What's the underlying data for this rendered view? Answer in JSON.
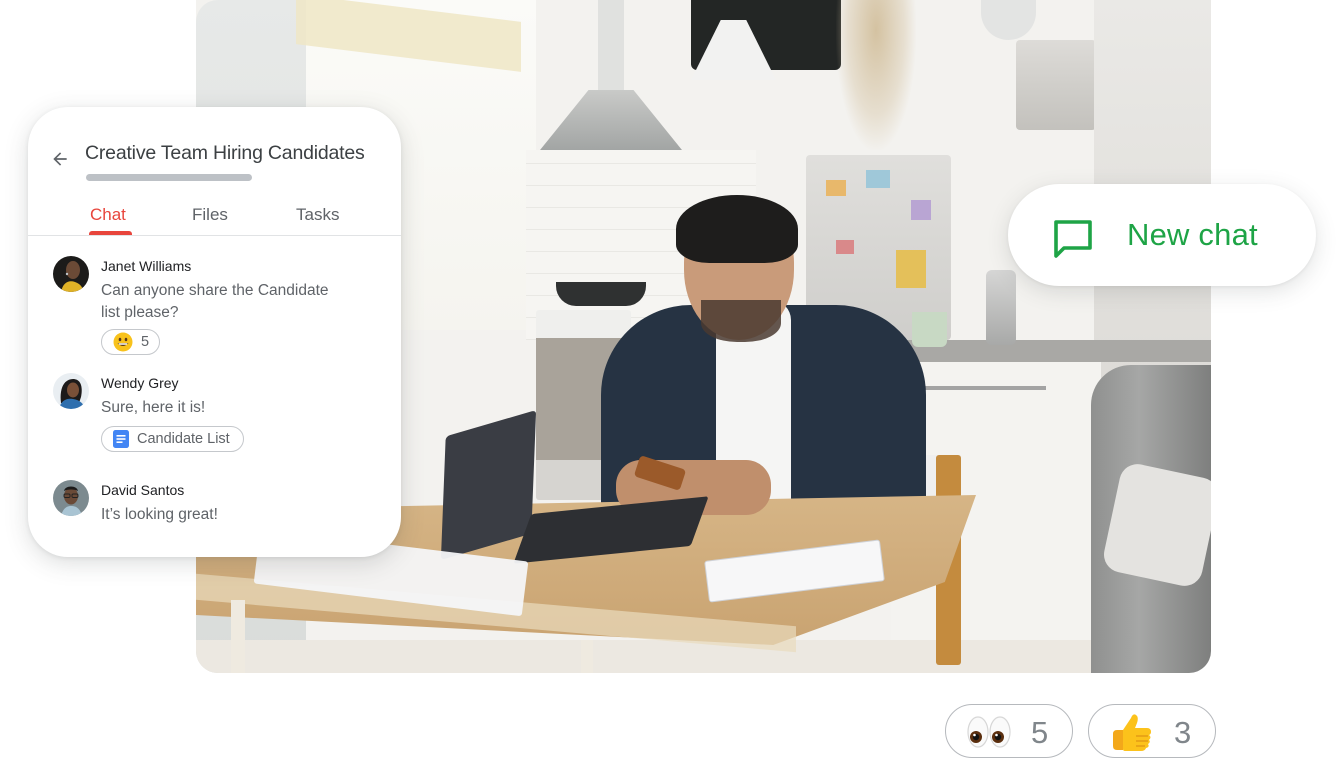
{
  "chat_card": {
    "back_icon": "arrow-left-icon",
    "title": "Creative Team Hiring Candidates",
    "tabs": [
      {
        "label": "Chat",
        "active": true
      },
      {
        "label": "Files",
        "active": false
      },
      {
        "label": "Tasks",
        "active": false
      }
    ],
    "messages": [
      {
        "sender": "Janet Williams",
        "text": "Can anyone share the Candidate list please?",
        "reaction": {
          "emoji": "grinning-face",
          "count": "5"
        }
      },
      {
        "sender": "Wendy Grey",
        "text": "Sure, here it is!",
        "attachment": {
          "icon": "google-docs-icon",
          "label": "Candidate List"
        }
      },
      {
        "sender": "David Santos",
        "text": "It’s looking great!"
      }
    ]
  },
  "new_chat": {
    "icon": "chat-bubble-icon",
    "label": "New chat",
    "color": "#1ea446"
  },
  "reactions": [
    {
      "emoji": "eyes",
      "count": "5"
    },
    {
      "emoji": "thumbs-up",
      "count": "3"
    }
  ],
  "colors": {
    "accent_red": "#e8453c",
    "docs_blue": "#4285f4",
    "text_primary": "#202124",
    "text_secondary": "#5f6368"
  }
}
